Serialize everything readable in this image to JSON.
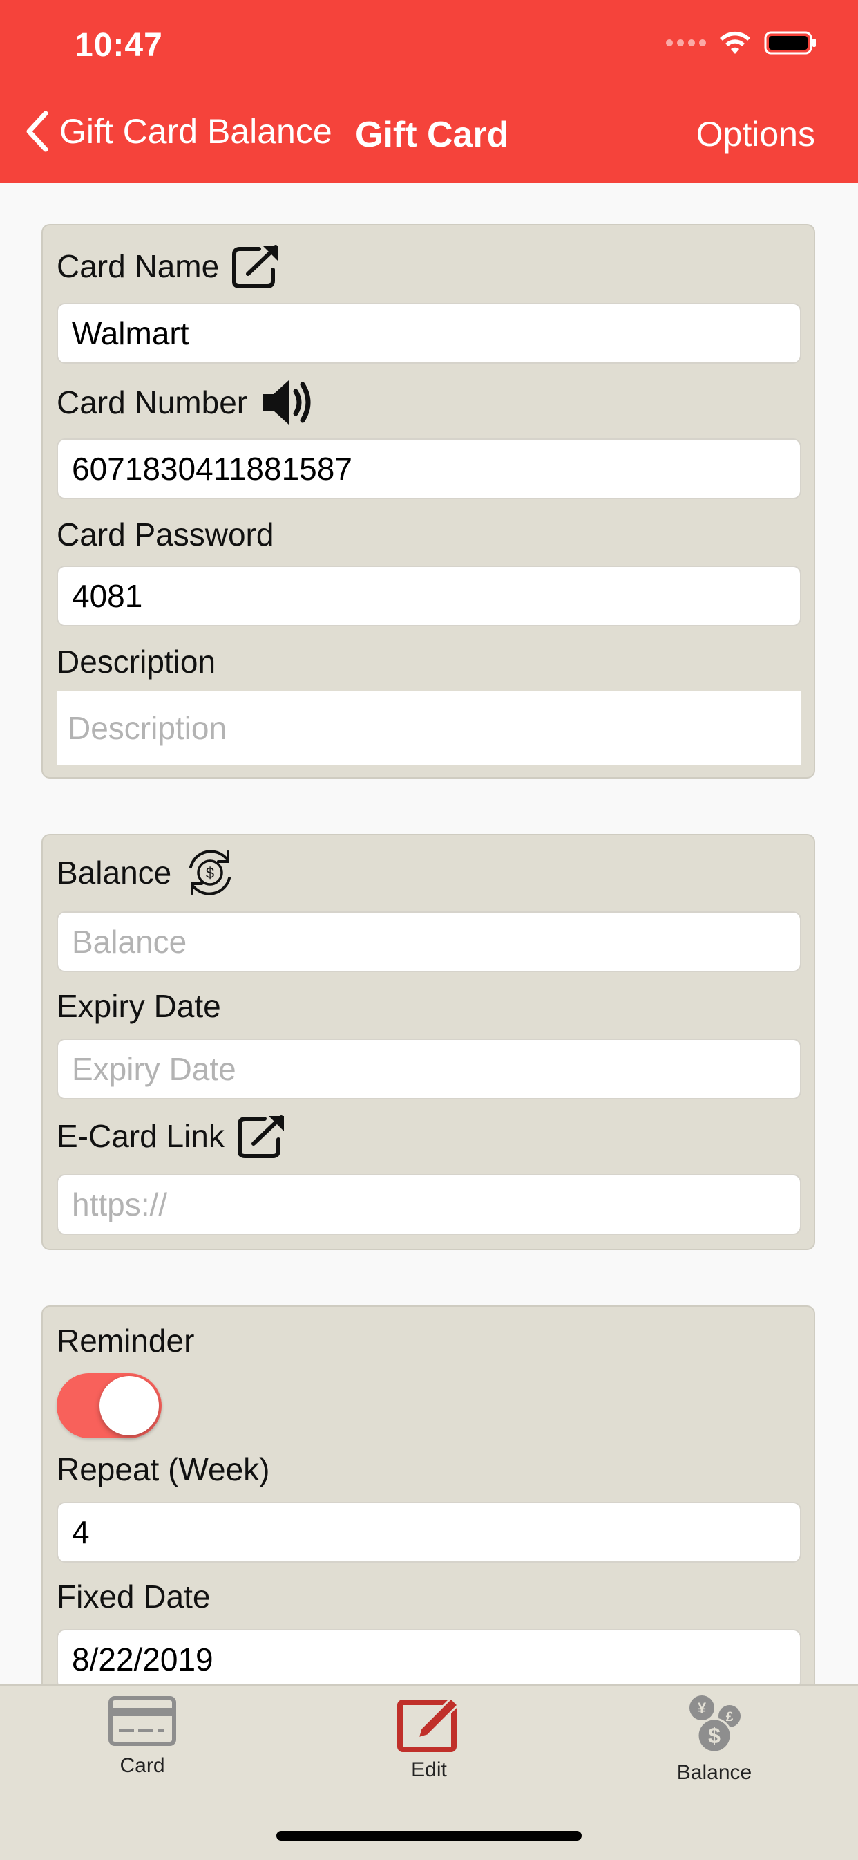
{
  "status_bar": {
    "time": "10:47"
  },
  "nav": {
    "back_label": "Gift Card Balance",
    "title": "Gift Card",
    "options_label": "Options"
  },
  "card_section": {
    "card_name_label": "Card Name",
    "card_name_value": "Walmart",
    "card_number_label": "Card Number",
    "card_number_value": "6071830411881587",
    "card_password_label": "Card Password",
    "card_password_value": "4081",
    "description_label": "Description",
    "description_placeholder": "Description"
  },
  "balance_section": {
    "balance_label": "Balance",
    "balance_placeholder": "Balance",
    "expiry_label": "Expiry Date",
    "expiry_placeholder": "Expiry Date",
    "ecard_label": "E-Card Link",
    "ecard_placeholder": "https://"
  },
  "reminder_section": {
    "reminder_label": "Reminder",
    "reminder_on": true,
    "repeat_label": "Repeat (Week)",
    "repeat_value": "4",
    "fixed_date_label": "Fixed Date",
    "fixed_date_value": "8/22/2019"
  },
  "tabs": [
    {
      "label": "Card",
      "icon": "card-icon"
    },
    {
      "label": "Edit",
      "icon": "edit-icon"
    },
    {
      "label": "Balance",
      "icon": "currency-coins-icon"
    }
  ],
  "colors": {
    "header": "#f5433b",
    "section_bg": "#e0ddd2",
    "toggle_on": "#f8615b",
    "edit_tab_accent": "#c0302a"
  }
}
